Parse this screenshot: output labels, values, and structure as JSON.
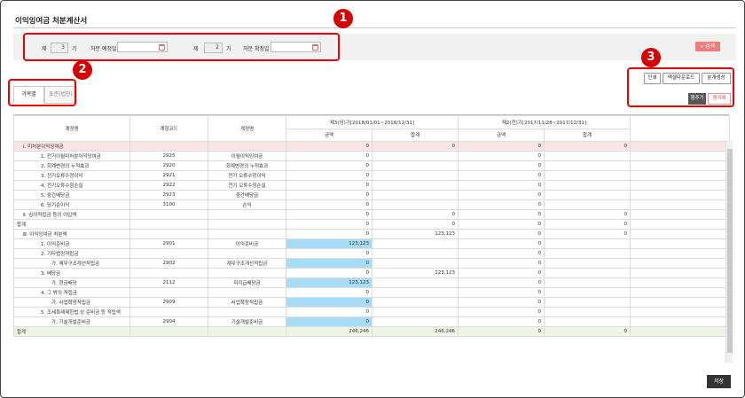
{
  "page": {
    "title": "이익잉여금 처분계산서"
  },
  "search": {
    "term_label": "제",
    "term_value": "3",
    "term_unit": "기",
    "planned_date_label": "처분 예정일",
    "term2_label": "제",
    "term2_value": "2",
    "term2_unit": "기",
    "confirmed_date_label": "처분 확정일",
    "search_button": "검색",
    "search_icon": "search-icon"
  },
  "tabs": [
    "과목별",
    "표준(법인)"
  ],
  "toolbar": {
    "print": "인쇄",
    "excel_download": "엑셀다운로드",
    "journal_create": "분개생성",
    "add_row": "행추가",
    "delete_row": "행삭제"
  },
  "annotations": [
    "1",
    "2",
    "3"
  ],
  "grid": {
    "headers": {
      "account_name": "계정명",
      "account_code": "계정코드",
      "account_name2": "계정명",
      "period3": "제3(당)기[2018/01/01~2018/12/31]",
      "period2": "제2(전)기[2017/11/28~2017/12/31]",
      "amount": "금액",
      "total": "합계"
    },
    "rows": [
      {
        "name": "Ⅰ. 미처분이익잉여금",
        "code": "",
        "acct": "",
        "a1": "0",
        "t1": "0",
        "a2": "0",
        "t2": "0",
        "pink": true,
        "indent": 0
      },
      {
        "name": "1. 전기이월미처분이익잉여금",
        "code": "2925",
        "acct": "이월이익잉여금",
        "a1": "0",
        "t1": "",
        "a2": "0",
        "t2": "",
        "indent": 1
      },
      {
        "name": "2. 회계변경의 누적효과",
        "code": "2920",
        "acct": "회계변경의 누적효과",
        "a1": "0",
        "t1": "",
        "a2": "0",
        "t2": "",
        "indent": 1
      },
      {
        "name": "3. 전기오류수정이익",
        "code": "2921",
        "acct": "전기 오류수정이익",
        "a1": "0",
        "t1": "",
        "a2": "0",
        "t2": "",
        "indent": 1
      },
      {
        "name": "4. 전기오류수정손실",
        "code": "2922",
        "acct": "전기 오류수정손실",
        "a1": "0",
        "t1": "",
        "a2": "0",
        "t2": "",
        "indent": 1
      },
      {
        "name": "5. 중간배당금",
        "code": "2923",
        "acct": "중간배당금",
        "a1": "0",
        "t1": "",
        "a2": "0",
        "t2": "",
        "indent": 1
      },
      {
        "name": "6. 당기순이익",
        "code": "3100",
        "acct": "손익",
        "a1": "0",
        "t1": "",
        "a2": "0",
        "t2": "",
        "indent": 1
      },
      {
        "name": "Ⅱ. 임의적립금 등의 이입액",
        "code": "",
        "acct": "",
        "a1": "0",
        "t1": "0",
        "a2": "0",
        "t2": "0",
        "indent": 0
      },
      {
        "name": "합계",
        "code": "",
        "acct": "",
        "a1": "0",
        "t1": "0",
        "a2": "0",
        "t2": "0",
        "indent": -1
      },
      {
        "name": "Ⅲ. 이익잉여금 처분액",
        "code": "",
        "acct": "",
        "a1": "0",
        "t1": "123,123",
        "a2": "0",
        "t2": "0",
        "indent": 0
      },
      {
        "name": "1. 이익준비금",
        "code": "2901",
        "acct": "이익준비금",
        "a1": "123,123",
        "t1": "",
        "a2": "0",
        "t2": "",
        "hl": true,
        "indent": 1
      },
      {
        "name": "2. 기타법정적립금",
        "code": "",
        "acct": "",
        "a1": "0",
        "t1": "",
        "a2": "0",
        "t2": "",
        "indent": 1
      },
      {
        "name": "가. 재무구조개선적립금",
        "code": "2902",
        "acct": "재무구조개선적립금",
        "a1": "0",
        "t1": "",
        "a2": "0",
        "t2": "",
        "hl": true,
        "indent": 2
      },
      {
        "name": "3. 배당금",
        "code": "",
        "acct": "",
        "a1": "0",
        "t1": "123,123",
        "a2": "0",
        "t2": "",
        "indent": 1
      },
      {
        "name": "가. 현금배당",
        "code": "2112",
        "acct": "미지급배당금",
        "a1": "123,123",
        "t1": "",
        "a2": "0",
        "t2": "",
        "hl": true,
        "indent": 2
      },
      {
        "name": "4. 그 밖의 적립금",
        "code": "",
        "acct": "",
        "a1": "0",
        "t1": "",
        "a2": "0",
        "t2": "",
        "indent": 1
      },
      {
        "name": "가. 사업확장적립금",
        "code": "2909",
        "acct": "사업확장적립금",
        "a1": "0",
        "t1": "",
        "a2": "0",
        "t2": "",
        "hl": true,
        "indent": 2
      },
      {
        "name": "5. 조세특례제한법 상 준비금 등 적립액",
        "code": "",
        "acct": "",
        "a1": "0",
        "t1": "",
        "a2": "0",
        "t2": "",
        "indent": 1
      },
      {
        "name": "가. 기술개발준비금",
        "code": "2904",
        "acct": "기술개발준비금",
        "a1": "0",
        "t1": "",
        "a2": "0",
        "t2": "",
        "hl": true,
        "indent": 2
      }
    ],
    "footer": {
      "name": "합계",
      "a1": "246,246",
      "t1": "246,246",
      "a2": "0",
      "t2": "0"
    }
  },
  "save_button": "저장",
  "colors": {
    "accent": "#ee7d7d",
    "callout": "#e00000",
    "highlight": "#a6dcf5",
    "pink_row": "#fbe4e4",
    "footer_row": "#eef5e6"
  }
}
